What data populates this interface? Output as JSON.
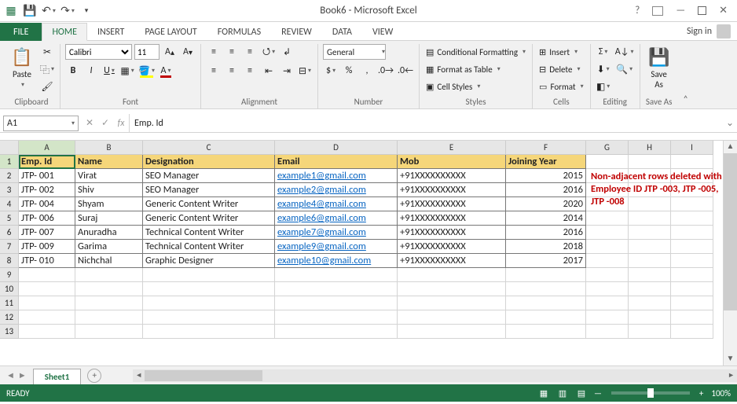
{
  "title": "Book6 - Microsoft Excel",
  "signin": "Sign in",
  "tabs": {
    "file": "FILE",
    "home": "HOME",
    "insert": "INSERT",
    "page": "PAGE LAYOUT",
    "formulas": "FORMULAS",
    "review": "REVIEW",
    "data": "DATA",
    "view": "VIEW"
  },
  "ribbon": {
    "clipboard": {
      "paste": "Paste",
      "label": "Clipboard"
    },
    "font": {
      "name": "Calibri",
      "size": "11",
      "label": "Font"
    },
    "alignment": {
      "label": "Alignment"
    },
    "number": {
      "format": "General",
      "label": "Number"
    },
    "styles": {
      "cf": "Conditional Formatting",
      "table": "Format as Table",
      "cell": "Cell Styles",
      "label": "Styles"
    },
    "cells": {
      "insert": "Insert",
      "delete": "Delete",
      "format": "Format",
      "label": "Cells"
    },
    "editing": {
      "label": "Editing"
    },
    "saveas": {
      "btn": "Save\nAs",
      "label": "Save As"
    }
  },
  "namebox": "A1",
  "formula": "Emp. Id",
  "columns": {
    "letters": [
      "A",
      "B",
      "C",
      "D",
      "E",
      "F",
      "G",
      "H",
      "I"
    ],
    "widths": [
      72,
      86,
      168,
      156,
      138,
      102,
      54,
      54,
      54
    ]
  },
  "headers": [
    "Emp. Id",
    "Name",
    "Designation",
    "Email",
    "Mob",
    "Joining Year"
  ],
  "rows": [
    {
      "id": "JTP- 001",
      "name": "Virat",
      "des": "SEO Manager",
      "email": "example1@gmail.com",
      "mob": "+91XXXXXXXXXX",
      "year": "2015"
    },
    {
      "id": "JTP- 002",
      "name": "Shiv",
      "des": "SEO Manager",
      "email": "example2@gmail.com",
      "mob": "+91XXXXXXXXXX",
      "year": "2016"
    },
    {
      "id": "JTP- 004",
      "name": "Shyam",
      "des": "Generic Content Writer",
      "email": "example4@gmail.com",
      "mob": "+91XXXXXXXXXX",
      "year": "2020"
    },
    {
      "id": "JTP- 006",
      "name": "Suraj",
      "des": "Generic Content Writer",
      "email": "example6@gmail.com",
      "mob": "+91XXXXXXXXXX",
      "year": "2014"
    },
    {
      "id": "JTP- 007",
      "name": "Anuradha",
      "des": "Technical Content Writer",
      "email": "example7@gmail.com",
      "mob": "+91XXXXXXXXXX",
      "year": "2016"
    },
    {
      "id": "JTP- 009",
      "name": "Garima",
      "des": "Technical Content Writer",
      "email": "example9@gmail.com",
      "mob": "+91XXXXXXXXXX",
      "year": "2018"
    },
    {
      "id": "JTP- 010",
      "name": "Nichchal",
      "des": "Graphic Designer",
      "email": "example10@gmail.com",
      "mob": "+91XXXXXXXXXX",
      "year": "2017"
    }
  ],
  "annotation": "Non-adjacent rows deleted with Employee ID JTP -003, JTP -005, JTP -008",
  "row_labels": [
    "1",
    "2",
    "3",
    "4",
    "5",
    "6",
    "7",
    "8",
    "9",
    "10",
    "11",
    "12",
    "13"
  ],
  "sheet_tab": "Sheet1",
  "status": "READY",
  "zoom": "100%"
}
